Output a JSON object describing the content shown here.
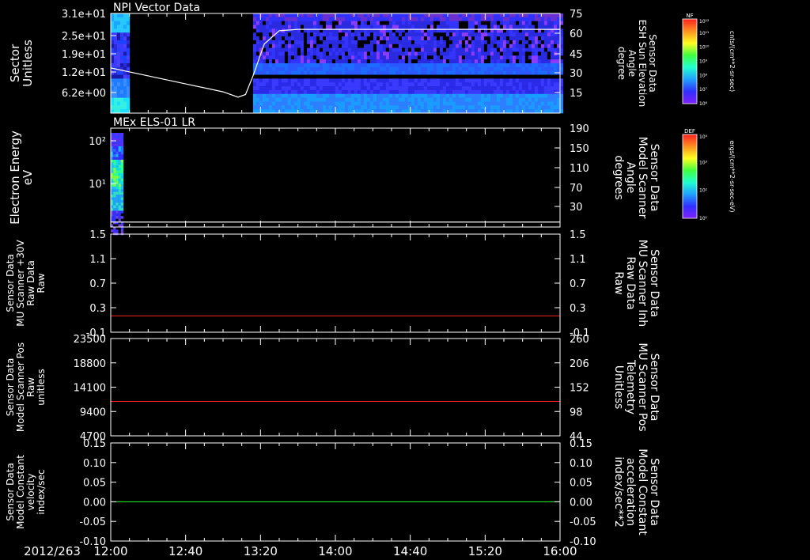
{
  "colors": {
    "background": "#000000",
    "text": "#ffffff",
    "red": "#ff2020",
    "green": "#20ff20"
  },
  "timeline": {
    "date_label": "2012/263",
    "x_ticks": [
      "12:00",
      "12:40",
      "13:20",
      "14:00",
      "14:40",
      "15:20",
      "16:00"
    ]
  },
  "colorbars": [
    {
      "tag": "NF",
      "top_label": "10¹²",
      "bottom_label": "10⁶",
      "ticks": [
        "10¹¹",
        "10¹⁰",
        "10⁹",
        "10⁸",
        "10⁷"
      ],
      "unit": "cnts/(cm**2-sr-sec)"
    },
    {
      "tag": "DEF",
      "top_label": "10⁴",
      "bottom_label": "10¹",
      "ticks": [
        "10³",
        "10²"
      ],
      "unit": "ergs/(cm**2-sr-sec-eV)"
    }
  ],
  "chart_data": [
    {
      "type": "heatmap",
      "title": "NPI Vector Data",
      "ylabel": [
        "Sector",
        "Unitless"
      ],
      "y_ticks": [
        "3.1e+01",
        "2.5e+01",
        "1.9e+01",
        "1.2e+01",
        "6.2e+00"
      ],
      "right_label": [
        "Sensor Data",
        "ESH Sun Elevation",
        "Angle",
        "degree"
      ],
      "right_ticks": [
        "75",
        "60",
        "45",
        "30",
        "15"
      ],
      "ylim_right": [
        0,
        75
      ],
      "data_intervals": [
        [
          "12:00",
          "12:09"
        ],
        [
          "13:16",
          "16:00"
        ]
      ],
      "line_series": {
        "name": "ESH Sun Elevation Angle",
        "x": [
          "12:00",
          "12:20",
          "12:40",
          "13:00",
          "13:08",
          "13:12",
          "13:16",
          "13:22",
          "13:30",
          "13:40",
          "14:00",
          "16:00"
        ],
        "y": [
          34,
          28,
          22,
          16,
          12,
          14,
          28,
          52,
          62,
          63,
          63,
          63
        ]
      }
    },
    {
      "type": "heatmap",
      "title": "MEx ELS-01 LR",
      "ylabel": [
        "Electron Energy",
        "eV"
      ],
      "y_ticks": [
        "10²",
        "10¹"
      ],
      "right_label": [
        "Sensor Data",
        "Model Scanner",
        "Angle",
        "degrees"
      ],
      "right_ticks": [
        "190",
        "150",
        "110",
        "70",
        "30"
      ],
      "ylim_right": [
        -10,
        190
      ],
      "data_intervals": [
        [
          "12:00",
          "12:06"
        ]
      ],
      "line_series": {
        "name": "Model Scanner Angle",
        "x": [
          "12:00",
          "16:00"
        ],
        "y": [
          0,
          0
        ]
      }
    },
    {
      "type": "line",
      "ylabel": [
        "Sensor Data",
        "MU Scanner +30V",
        "Raw Data",
        "Raw"
      ],
      "y_ticks": [
        "1.5",
        "1.1",
        "0.7",
        "0.3",
        "-0.1"
      ],
      "ylim": [
        -0.3,
        1.5
      ],
      "right_label": [
        "Sensor Data",
        "MU Scanner Inh",
        "Raw Data",
        "Raw"
      ],
      "right_ticks": [
        "1.5",
        "1.1",
        "0.7",
        "0.3",
        "-0.1"
      ],
      "series": [
        {
          "x": [
            "12:00",
            "16:00"
          ],
          "values": [
            0,
            0
          ],
          "color": "#ff2020"
        }
      ]
    },
    {
      "type": "line",
      "ylabel": [
        "Sensor Data",
        "Model Scanner Pos",
        "Raw",
        "unitless"
      ],
      "y_ticks": [
        "23500",
        "18800",
        "14100",
        "9400",
        "4700"
      ],
      "ylim": [
        0,
        23500
      ],
      "right_label": [
        "Sensor Data",
        "MU Scanner Pos",
        "Telemetry",
        "Unitless"
      ],
      "right_ticks": [
        "260",
        "206",
        "152",
        "98",
        "44"
      ],
      "series": [
        {
          "x": [
            "12:00",
            "16:00"
          ],
          "values": [
            8300,
            8300
          ],
          "color": "#ff2020"
        }
      ]
    },
    {
      "type": "line",
      "ylabel": [
        "Sensor Data",
        "Model Constant",
        "velocity",
        "index/sec"
      ],
      "y_ticks": [
        "0.15",
        "0.10",
        "0.05",
        "0.00",
        "-0.05",
        "-0.10"
      ],
      "ylim": [
        -0.1,
        0.15
      ],
      "right_label": [
        "Sensor Data",
        "Model Constant",
        "acceleration",
        "index/sec**2"
      ],
      "right_ticks": [
        "0.15",
        "0.10",
        "0.05",
        "0.00",
        "-0.05",
        "-0.10"
      ],
      "series": [
        {
          "x": [
            "12:00",
            "16:00"
          ],
          "values": [
            0,
            0
          ],
          "color": "#20ff20"
        }
      ]
    }
  ]
}
